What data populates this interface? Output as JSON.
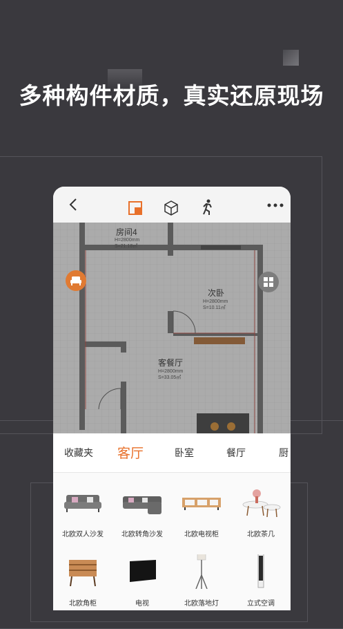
{
  "headline": "多种构件材质，真实还原现场",
  "plan": {
    "rooms": [
      {
        "name": "房间4",
        "height": "H=2800mm",
        "area": "S=21.18㎡"
      },
      {
        "name": "次卧",
        "height": "H=2800mm",
        "area": "S=10.11㎡"
      },
      {
        "name": "客餐厅",
        "height": "H=2800mm",
        "area": "S=33.05㎡"
      }
    ]
  },
  "tabs": [
    {
      "label": "收藏夹"
    },
    {
      "label": "客厅"
    },
    {
      "label": "卧室"
    },
    {
      "label": "餐厅"
    },
    {
      "label": "厨"
    }
  ],
  "active_tab": "客厅",
  "items": [
    {
      "label": "北欧双人沙发",
      "icon": "sofa-icon"
    },
    {
      "label": "北欧转角沙发",
      "icon": "corner-sofa-icon"
    },
    {
      "label": "北欧电视柜",
      "icon": "tv-cabinet-icon"
    },
    {
      "label": "北欧茶几",
      "icon": "coffee-table-icon"
    },
    {
      "label": "北欧角柜",
      "icon": "corner-cabinet-icon"
    },
    {
      "label": "电视",
      "icon": "tv-icon"
    },
    {
      "label": "北欧落地灯",
      "icon": "floor-lamp-icon"
    },
    {
      "label": "立式空调",
      "icon": "air-conditioner-icon"
    }
  ],
  "colors": {
    "accent": "#e8702a",
    "background": "#3a393e"
  }
}
